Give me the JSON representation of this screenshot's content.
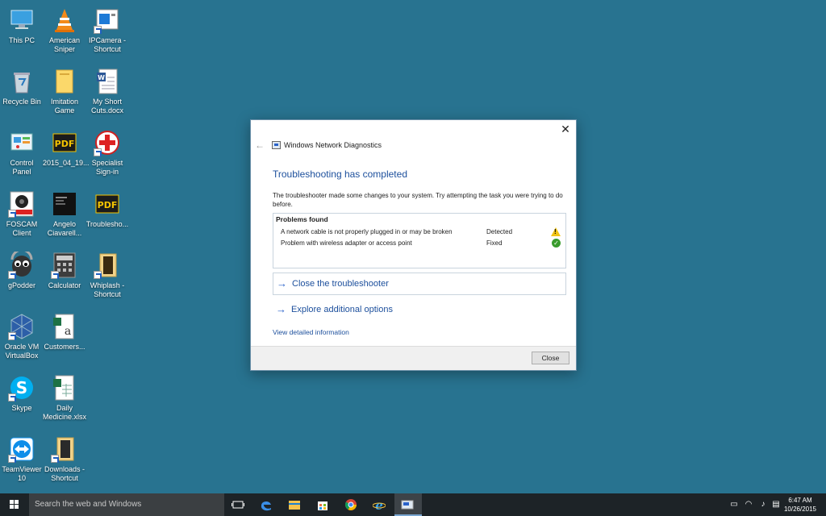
{
  "desktop": {
    "icons": [
      {
        "label": "This PC"
      },
      {
        "label": "American Sniper"
      },
      {
        "label": "IPCamera - Shortcut"
      },
      {
        "label": "Recycle Bin"
      },
      {
        "label": "Imitation Game"
      },
      {
        "label": "My Short Cuts.docx"
      },
      {
        "label": "Control Panel"
      },
      {
        "label": "2015_04_19..."
      },
      {
        "label": "Specialist Sign-in"
      },
      {
        "label": "FOSCAM Client"
      },
      {
        "label": "Angelo Ciavarell..."
      },
      {
        "label": "Troublesho..."
      },
      {
        "label": "gPodder"
      },
      {
        "label": "Calculator"
      },
      {
        "label": "Whiplash - Shortcut"
      },
      {
        "label": "Oracle VM VirtualBox"
      },
      {
        "label": "Customers..."
      },
      {
        "label": "Skype"
      },
      {
        "label": "Daily Medicine.xlsx"
      },
      {
        "label": "TeamViewer 10"
      },
      {
        "label": "Downloads - Shortcut"
      }
    ],
    "foscam_badge": "FOSCAM"
  },
  "dialog": {
    "title": "Windows Network Diagnostics",
    "heading": "Troubleshooting has completed",
    "description": "The troubleshooter made some changes to your system. Try attempting the task you were trying to do before.",
    "problems_header": "Problems found",
    "problems": [
      {
        "text": "A network cable is not properly plugged in or may be broken",
        "status": "Detected",
        "icon": "warning-icon"
      },
      {
        "text": "Problem with wireless adapter or access point",
        "status": "Fixed",
        "icon": "check-icon"
      }
    ],
    "close_troubleshooter": "Close the troubleshooter",
    "explore_options": "Explore additional options",
    "view_details": "View detailed information",
    "close_button": "Close"
  },
  "taskbar": {
    "search_placeholder": "Search the web and Windows",
    "time": "6:47 AM",
    "date": "10/26/2015"
  },
  "colors": {
    "desktop_bg": "#287390",
    "link_blue": "#1c4f9c",
    "taskbar_bg": "#1d2327"
  }
}
